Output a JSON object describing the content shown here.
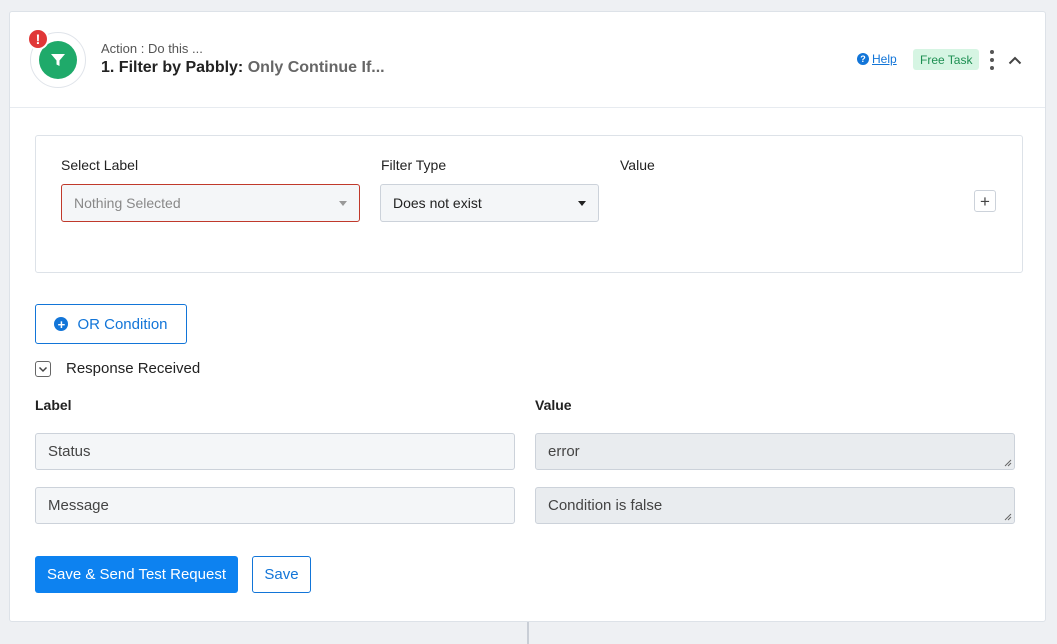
{
  "header": {
    "action_label": "Action : Do this ...",
    "step_title": "1. Filter by Pabbly:",
    "step_subtitle": "Only Continue If...",
    "alert_badge": "!",
    "help_label": "Help",
    "help_icon": "?",
    "free_task_label": "Free Task"
  },
  "filter": {
    "select_label_heading": "Select Label",
    "select_label_value": "Nothing Selected",
    "filter_type_heading": "Filter Type",
    "filter_type_value": "Does not exist",
    "value_heading": "Value",
    "add_label": "+"
  },
  "or_condition": {
    "label": "OR Condition",
    "icon": "+"
  },
  "response": {
    "toggle_label": "Response Received",
    "label_heading": "Label",
    "value_heading": "Value",
    "rows": [
      {
        "label": "Status",
        "value": "error"
      },
      {
        "label": "Message",
        "value": "Condition is false"
      }
    ]
  },
  "actions": {
    "save_send_label": "Save & Send Test Request",
    "save_label": "Save"
  },
  "colors": {
    "accent": "#1275d8",
    "primary_button": "#0d82f0",
    "app_icon": "#1faa6a",
    "alert": "#e03737",
    "free_task_bg": "#d6f5e3"
  },
  "icons": {
    "app": "filter-icon",
    "alert": "exclamation-icon",
    "help": "question-circle-icon",
    "menu": "kebab-menu-icon",
    "collapse": "chevron-up-icon",
    "toggle": "chevron-down-icon"
  }
}
